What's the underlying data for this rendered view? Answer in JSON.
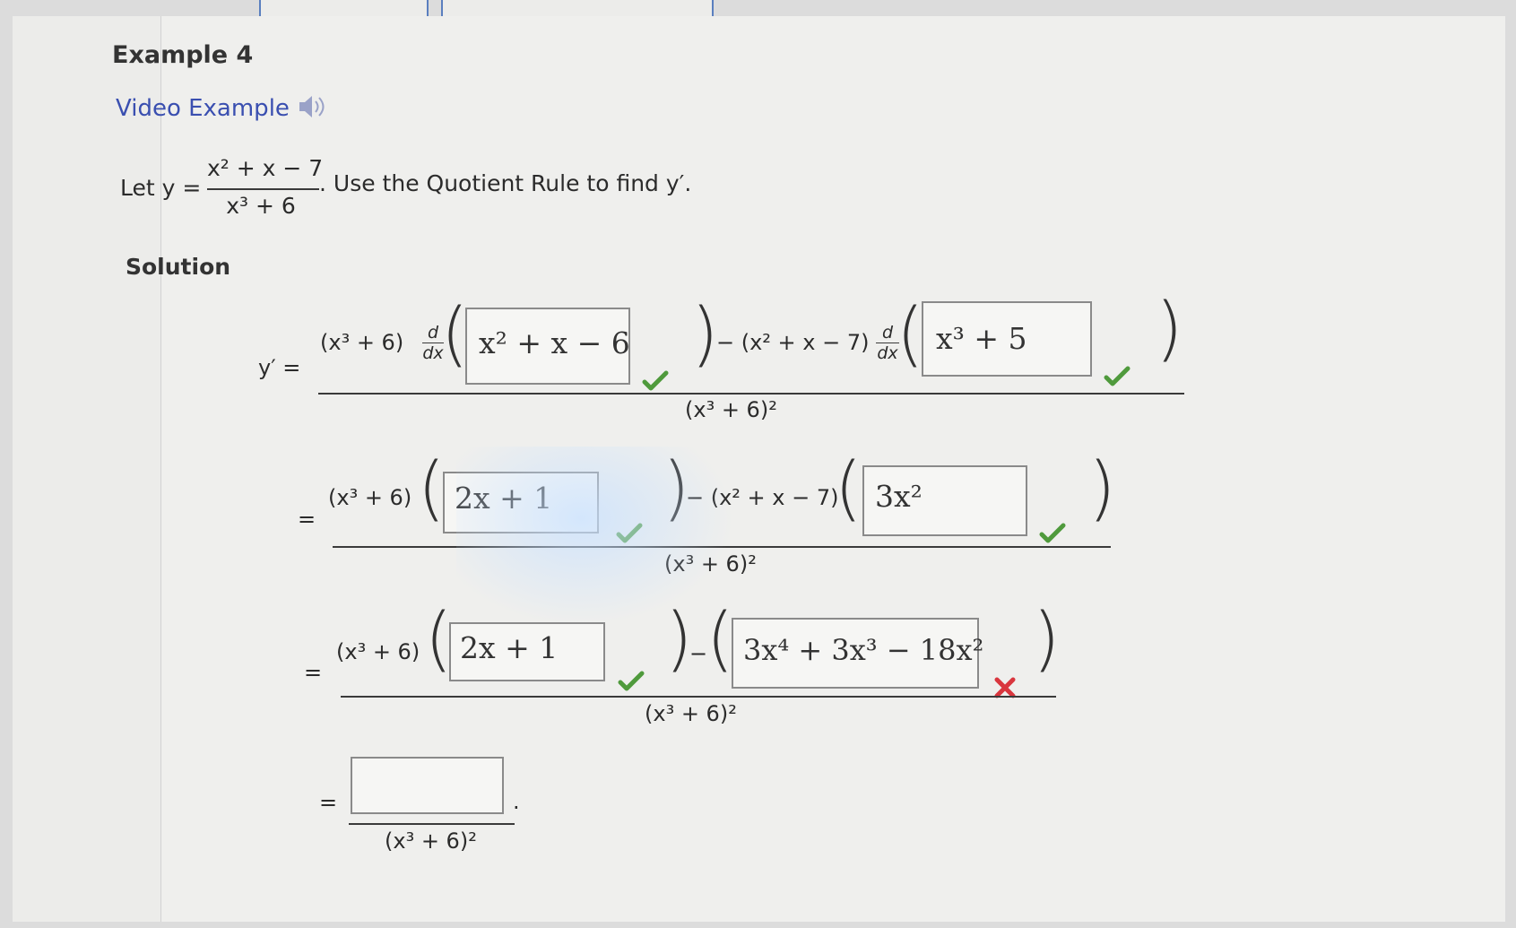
{
  "header": {
    "title": "Example 4",
    "video_link": "Video Example",
    "video_icon": "speaker-icon"
  },
  "problem": {
    "let_text": "Let y =",
    "numerator": "x² + x − 7",
    "denominator": "x³ + 6",
    "instruction": ". Use the Quotient Rule to find y′."
  },
  "solution": {
    "label": "Solution",
    "step1": {
      "lhs": "y′ =",
      "num_left": "(x³ + 6)",
      "deriv_n": "d",
      "deriv_d": "dx",
      "answer1": "x² + x − 6",
      "answer1_status": "correct",
      "mid": "− (x² + x − 7)",
      "answer2": "x³ + 5",
      "answer2_status": "correct",
      "denominator": "(x³ + 6)²"
    },
    "step2": {
      "eq": "=",
      "num_left": "(x³ + 6)",
      "answer1": "2x + 1",
      "answer1_status": "correct",
      "mid": "− (x² + x − 7)",
      "answer2": "3x²",
      "answer2_status": "correct",
      "denominator": "(x³ + 6)²"
    },
    "step3": {
      "eq": "=",
      "num_left": "(x³ + 6)",
      "answer1": "2x + 1",
      "answer1_status": "correct",
      "mid": "−",
      "answer2": "3x⁴ + 3x³ − 18x²",
      "answer2_status": "incorrect",
      "denominator": "(x³ + 6)²"
    },
    "step4": {
      "eq": "=",
      "answer": "",
      "period": ".",
      "denominator": "(x³ + 6)²"
    }
  },
  "colors": {
    "check": "#4f9a3c",
    "cross": "#d9363e",
    "link": "#3a4fb0"
  }
}
